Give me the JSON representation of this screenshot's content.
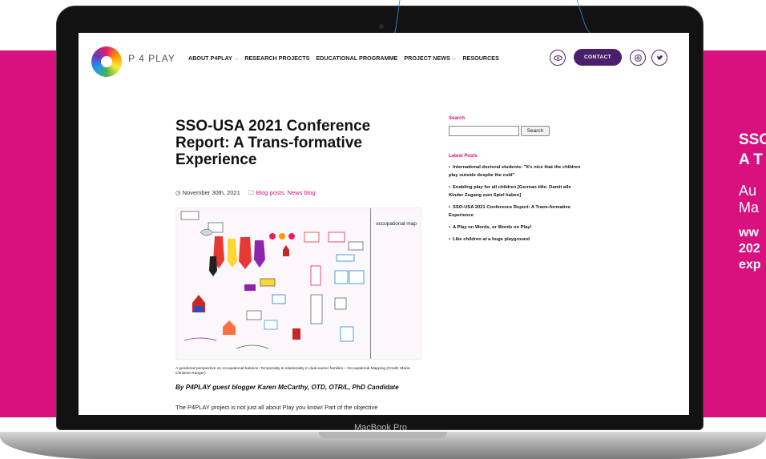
{
  "promo": {
    "title_line1": "SSO",
    "title_line2": "A T",
    "subtitle_line1": "Au",
    "subtitle_line2": "Ma",
    "url_line1": "ww",
    "url_line2": "202",
    "url_line3": "exp"
  },
  "device": {
    "label": "MacBook Pro"
  },
  "site": {
    "name": "P 4 PLAY",
    "nav": [
      {
        "label": "ABOUT P4PLAY",
        "has_dropdown": true
      },
      {
        "label": "RESEARCH PROJECTS",
        "has_dropdown": false
      },
      {
        "label": "EDUCATIONAL PROGRAMME",
        "has_dropdown": false
      },
      {
        "label": "PROJECT NEWS",
        "has_dropdown": true
      },
      {
        "label": "RESOURCES",
        "has_dropdown": false
      }
    ],
    "contact_label": "CONTACT",
    "chevron_glyph": "⌵",
    "icons": {
      "eye": "eye-icon",
      "instagram": "instagram-icon",
      "twitter": "twitter-icon"
    }
  },
  "article": {
    "title": "SSO-USA 2021 Conference Report: A Trans-formative Experience",
    "date": "November 30th, 2021",
    "categories": "Blog posts, News blog",
    "figure_label": "occupational map",
    "caption": "A gendered perspective on occupational balance: Temporality & relationality in dual earner families – Occupational Mapping (Credit: Marie-Christine Ranger)",
    "byline": "By P4PLAY guest blogger Karen McCarthy, OTD, OTR/L, PhD Candidate",
    "intro": "The P4PLAY project is not just all about Play you know!  Part of the objective"
  },
  "sidebar": {
    "search_heading": "Search",
    "search_button": "Search",
    "latest_heading": "Latest Posts",
    "posts": [
      "International doctoral students: \"It's nice that the children play outside despite the cold\"",
      "Enabling play for all children [German title: Damit alle Kinder Zugang zum Spiel haben]",
      "SSO-USA 2021 Conference Report: A Trans-formative Experience",
      "A Play on Words, or Words on Play!",
      "Like children at a huge playground"
    ]
  },
  "colors": {
    "accent": "#d9117e",
    "contact": "#4b1f6b"
  }
}
